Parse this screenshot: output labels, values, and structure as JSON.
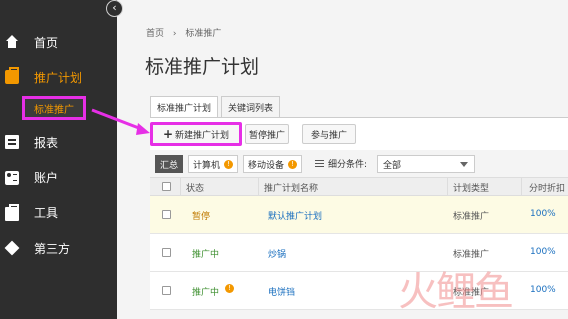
{
  "sidebar": {
    "items": [
      {
        "label": "首页",
        "icon": "home-icon"
      },
      {
        "label": "推广计划",
        "icon": "briefcase-icon"
      },
      {
        "label": "报表",
        "icon": "report-icon"
      },
      {
        "label": "账户",
        "icon": "account-card-icon"
      },
      {
        "label": "工具",
        "icon": "toolbox-icon"
      },
      {
        "label": "第三方",
        "icon": "diamond-icon"
      }
    ],
    "sub_item": "标准推广",
    "collapse_icon": "‹"
  },
  "breadcrumb": {
    "home": "首页",
    "sep": "›",
    "current": "标准推广"
  },
  "page_title": "标准推广计划",
  "tabs": [
    {
      "label": "标准推广计划",
      "active": true
    },
    {
      "label": "关键词列表",
      "active": false
    }
  ],
  "toolbar": {
    "new_plus": "+",
    "new_label": "新建推广计划",
    "pause_label": "暂停推广",
    "join_label": "参与推广"
  },
  "filters": {
    "summary": "汇总",
    "computer": "计算机",
    "computer_badge": "!",
    "mobile": "移动设备",
    "mobile_badge": "!",
    "cond_label": "细分条件:",
    "select_value": "全部"
  },
  "table": {
    "headers": [
      "状态",
      "推广计划名称",
      "计划类型",
      "分时折扣"
    ],
    "rows": [
      {
        "status": "暂停",
        "name": "默认推广计划",
        "type": "标准推广",
        "discount": "100%"
      },
      {
        "status": "推广中",
        "name": "炒锅",
        "type": "标准推广",
        "discount": "100%"
      },
      {
        "status": "推广中",
        "name": "电饼铛",
        "type": "标准推广",
        "discount": "100%",
        "warn": "!"
      }
    ]
  },
  "watermark": "火鲤鱼",
  "colors": {
    "accent": "#f39800",
    "highlight_box": "#e62fe6",
    "sidebar_bg": "#2e2e2e",
    "link": "#1a6fbf"
  }
}
